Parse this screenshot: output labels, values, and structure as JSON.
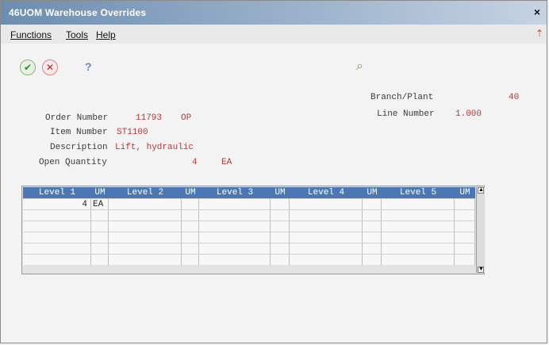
{
  "window": {
    "title": "46UOM  Warehouse Overrides"
  },
  "menubar": {
    "items": [
      "Functions",
      "Tools",
      "Help"
    ]
  },
  "toolbar": {
    "help_label": "?"
  },
  "form": {
    "order_number_label": "Order Number",
    "order_number_value": "11793",
    "order_type_value": "OP",
    "item_number_label": "Item Number",
    "item_number_value": "ST1100",
    "description_label": "Description",
    "description_value": "Lift, hydraulic",
    "open_quantity_label": "Open Quantity",
    "open_quantity_value": "4",
    "open_quantity_uom": "EA",
    "branch_plant_label": "Branch/Plant",
    "branch_plant_value": "40",
    "line_number_label": "Line Number",
    "line_number_value": "1.000"
  },
  "grid": {
    "headers": [
      "Level 1",
      "UM",
      "Level 2",
      "UM",
      "Level 3",
      "UM",
      "Level 4",
      "UM",
      "Level 5",
      "UM"
    ],
    "rows": [
      [
        "4",
        "EA",
        "",
        "",
        "",
        "",
        "",
        "",
        "",
        ""
      ],
      [
        "",
        "",
        "",
        "",
        "",
        "",
        "",
        "",
        "",
        ""
      ],
      [
        "",
        "",
        "",
        "",
        "",
        "",
        "",
        "",
        "",
        ""
      ],
      [
        "",
        "",
        "",
        "",
        "",
        "",
        "",
        "",
        "",
        ""
      ],
      [
        "",
        "",
        "",
        "",
        "",
        "",
        "",
        "",
        "",
        ""
      ],
      [
        "",
        "",
        "",
        "",
        "",
        "",
        "",
        "",
        "",
        ""
      ]
    ]
  }
}
